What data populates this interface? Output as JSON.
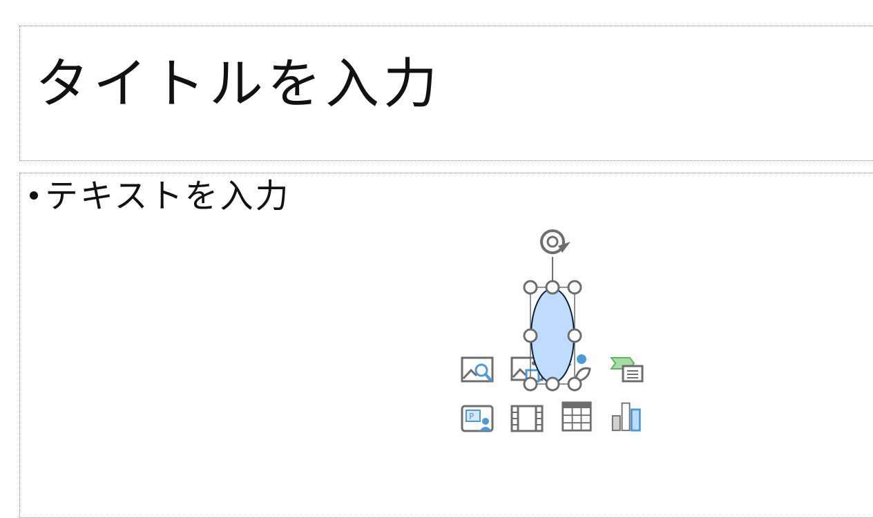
{
  "slide": {
    "title_placeholder": "タイトルを入力",
    "body_bullets": [
      "テキストを入力"
    ]
  },
  "content_insert_icons": [
    {
      "name": "online-picture-icon"
    },
    {
      "name": "picture-icon"
    },
    {
      "name": "icons-icon"
    },
    {
      "name": "smartart-icon"
    },
    {
      "name": "cameo-icon"
    },
    {
      "name": "video-icon"
    },
    {
      "name": "table-icon"
    },
    {
      "name": "chart-icon"
    }
  ],
  "selected_shape": {
    "type": "ellipse",
    "fill": "#bfdcff",
    "stroke": "#0d1f33"
  },
  "colors": {
    "handle": "#6d6d6d",
    "accent_blue": "#4a9ad8",
    "accent_green": "#5cb85c"
  }
}
